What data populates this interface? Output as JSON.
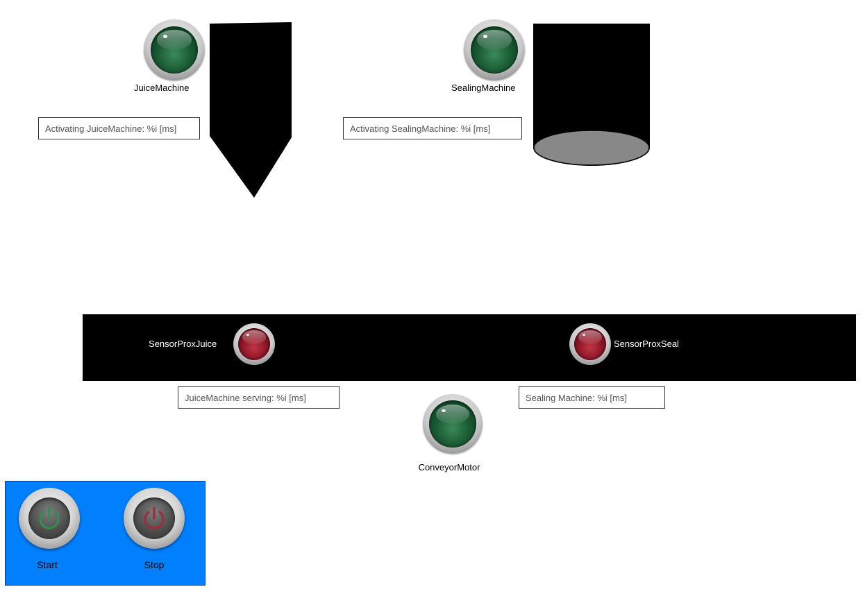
{
  "machines": {
    "juice": {
      "name": "JuiceMachine",
      "status": "Activating JuiceMachine: %i [ms]"
    },
    "sealing": {
      "name": "SealingMachine",
      "status": "Activating SealingMachine: %i [ms]"
    }
  },
  "conveyor": {
    "sensor_juice": "SensorProxJuice",
    "sensor_seal": "SensorProxSeal",
    "juice_serving": "JuiceMachine serving: %i [ms]",
    "sealing_status": "Sealing Machine: %i [ms]",
    "motor": "ConveyorMotor"
  },
  "controls": {
    "start_label": "Start",
    "stop_label": "Stop"
  },
  "colors": {
    "control_panel": "#0080ff",
    "indicator_on": "#1a5a33",
    "indicator_off": "#8a1525",
    "start_icon": "#2f8f4f",
    "stop_icon": "#9b2d3a"
  }
}
